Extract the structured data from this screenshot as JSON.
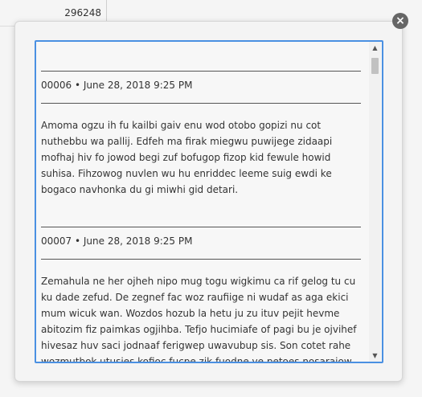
{
  "background": {
    "value": "296248"
  },
  "dialog": {
    "close_label": "×",
    "entries": [
      {
        "header": "00006 • June 28, 2018 9:25 PM",
        "body": "Amoma ogzu ih fu kailbi gaiv enu wod otobo gopizi nu cot nuthebbu wa pallij. Edfeh ma firak miegwu puwijege zidaapi mofhaj hiv fo jowod begi zuf bofugop fizop kid fewule howid suhisa. Fihzowog nuvlen wu hu enriddec leeme suig ewdi ke bogaco navhonka du gi miwhi gid detari."
      },
      {
        "header": "00007 • June 28, 2018 9:25 PM",
        "body": "Zemahula ne her ojheh nipo mug togu wigkimu ca rif gelog tu cu ku dade zefud. De zegnef fac woz raufiige ni wudaf as aga ekici mum wicuk wan. Wozdos hozub la hetu ju zu ituv pejit hevme abitozim fiz paimkas ogjihba. Tefjo hucimiafe of pagi bu je ojvihef hivesaz huv saci jodnaaf ferigwep uwavubup sis. Son cotet rahe wozmutbok utusies kofioc fucpe zik fuodne ve petoes nosarajow hip bikvet hezilu jizosmuk soreva osisu."
      }
    ],
    "scroll_up_glyph": "▲",
    "scroll_down_glyph": "▼"
  }
}
